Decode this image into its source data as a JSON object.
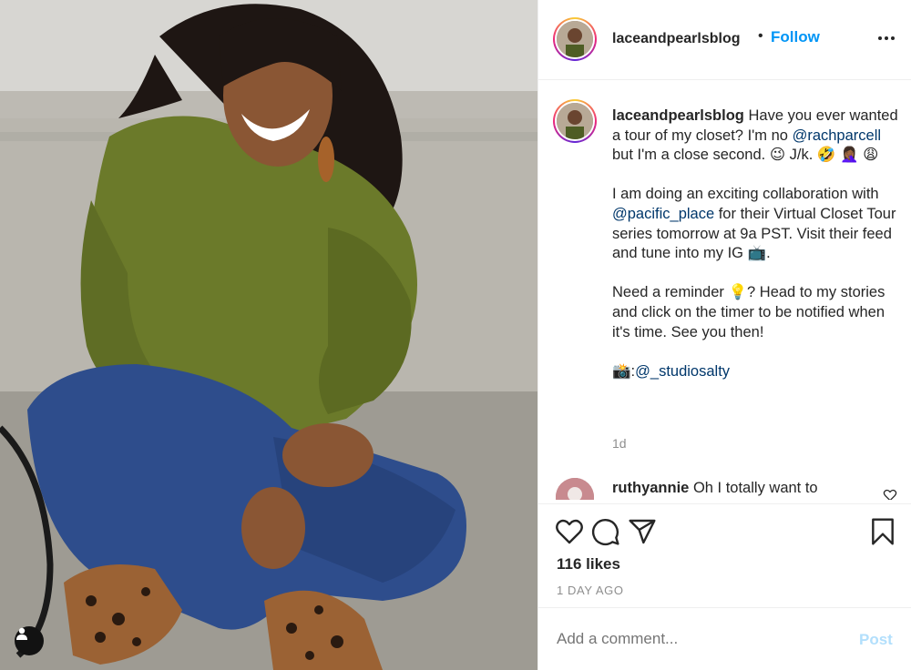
{
  "post": {
    "username": "laceandpearlsblog",
    "follow_label": "Follow",
    "dot": "•"
  },
  "caption": {
    "username": "laceandpearlsblog",
    "line1": "Have you ever wanted a tour of my closet? I'm no ",
    "mention1": "@rachparcell",
    "line1b": " but I'm a close second. 😉 J/k. 🤣 🤦🏾‍♀️ 😩",
    "p2a": "I am doing an exciting collaboration with ",
    "mention2": "@pacific_place",
    "p2b": " for their Virtual Closet Tour series tomorrow at 9a PST. Visit their feed and tune into my IG 📺.",
    "p3": "Need a reminder 💡? Head to my stories and click on the timer to be notified when it's time. See you then!",
    "p4_icon": "📸",
    "p4_sep": ":",
    "mention3": "@_studiosalty",
    "age": "1d"
  },
  "comment": {
    "username": "ruthyannie",
    "text": "Oh I totally want to"
  },
  "actions": {
    "likes": "116 likes",
    "ago": "1 DAY AGO"
  },
  "add_comment": {
    "placeholder": "Add a comment...",
    "post_label": "Post"
  },
  "icons": [
    "user-tag-icon",
    "more-options-icon",
    "heart-icon",
    "comment-icon",
    "share-icon",
    "bookmark-icon",
    "small-heart-icon"
  ],
  "colors": {
    "link": "#0095f6",
    "mention": "#00376b",
    "muted": "#8e8e8e",
    "post_disabled": "#b2dffc"
  }
}
